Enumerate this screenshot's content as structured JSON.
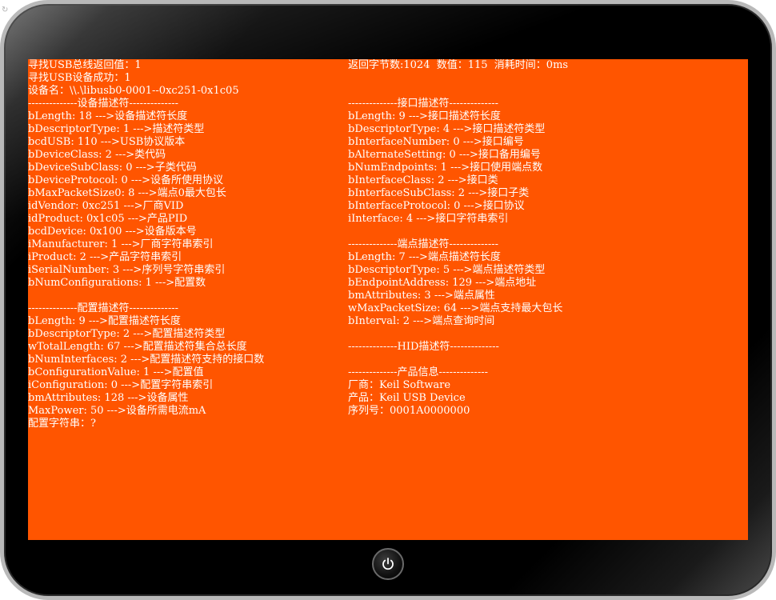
{
  "left_lines": [
    "寻找USB总线返回值：1",
    "寻找USB设备成功：1",
    "设备名：\\\\.\\libusb0-0001--0xc251-0x1c05",
    "--------------设备描述符--------------",
    "bLength: 18 --->设备描述符长度",
    "bDescriptorType: 1 --->描述符类型",
    "bcdUSB: 110 --->USB协议版本",
    "bDeviceClass: 2 --->类代码",
    "bDeviceSubClass: 0 --->子类代码",
    "bDeviceProtocol: 0 --->设备所使用协议",
    "bMaxPacketSize0: 8 --->端点0最大包长",
    "idVendor: 0xc251 --->厂商VID",
    "idProduct: 0x1c05 --->产品PID",
    "bcdDevice: 0x100 --->设备版本号",
    "iManufacturer: 1 --->厂商字符串索引",
    "iProduct: 2 --->产品字符串索引",
    "iSerialNumber: 3 --->序列号字符串索引",
    "bNumConfigurations: 1 --->配置数",
    "",
    "--------------配置描述符--------------",
    "bLength: 9 --->配置描述符长度",
    "bDescriptorType: 2 --->配置描述符类型",
    "wTotalLength: 67 --->配置描述符集合总长度",
    "bNumInterfaces: 2 --->配置描述符支持的接口数",
    "bConfigurationValue: 1 --->配置值",
    "iConfiguration: 0 --->配置字符串索引",
    "bmAttributes: 128 --->设备属性",
    "MaxPower: 50 --->设备所需电流mA",
    "配置字符串：?"
  ],
  "right_lines": [
    "返回字节数:1024  数值：115  消耗时间：0ms",
    "",
    "",
    "--------------接口描述符--------------",
    "bLength: 9 --->接口描述符长度",
    "bDescriptorType: 4 --->接口描述符类型",
    "bInterfaceNumber: 0 --->接口编号",
    "bAlternateSetting: 0 --->接口备用编号",
    "bNumEndpoints: 1 --->接口使用端点数",
    "bInterfaceClass: 2 --->接口类",
    "bInterfaceSubClass: 2 --->接口子类",
    "bInterfaceProtocol: 0 --->接口协议",
    "iInterface: 4 --->接口字符串索引",
    "",
    "--------------端点描述符--------------",
    "bLength: 7 --->端点描述符长度",
    "bDescriptorType: 5 --->端点描述符类型",
    "bEndpointAddress: 129 --->端点地址",
    "bmAttributes: 3 --->端点属性",
    "wMaxPacketSize: 64 --->端点支持最大包长",
    "bInterval: 2 --->端点查询时间",
    "",
    "--------------HID描述符--------------",
    "",
    "--------------产品信息--------------",
    "厂商：Keil Software",
    "产品：Keil USB Device",
    "序列号：0001A0000000"
  ],
  "colors": {
    "screen_bg": "#ff5500",
    "text": "#ffffff",
    "bezel": "#000000"
  },
  "icons": {
    "home_button": "power-icon"
  }
}
